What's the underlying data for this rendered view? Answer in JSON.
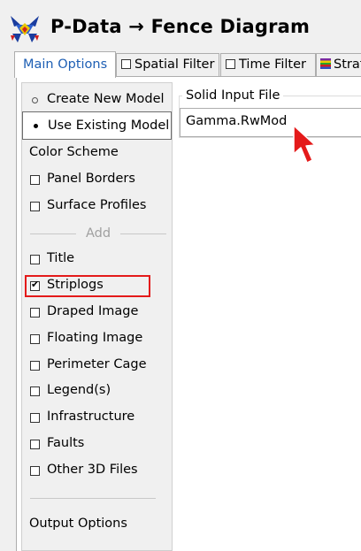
{
  "window": {
    "title": "P-Data → Fence Diagram"
  },
  "tabs": [
    {
      "label": "Main Options"
    },
    {
      "label": "Spatial Filter"
    },
    {
      "label": "Time Filter"
    },
    {
      "label": "Strat"
    }
  ],
  "model_options": [
    {
      "label": "Create New Model",
      "selected": false
    },
    {
      "label": "Use Existing Model",
      "selected": true
    }
  ],
  "left_panel": {
    "color_scheme": "Color Scheme",
    "panel_borders": "Panel Borders",
    "surface_profiles": "Surface Profiles",
    "add_divider": "Add",
    "items": [
      {
        "label": "Title",
        "checked": false
      },
      {
        "label": "Striplogs",
        "checked": true
      },
      {
        "label": "Draped Image",
        "checked": false
      },
      {
        "label": "Floating Image",
        "checked": false
      },
      {
        "label": "Perimeter Cage",
        "checked": false
      },
      {
        "label": "Legend(s)",
        "checked": false
      },
      {
        "label": "Infrastructure",
        "checked": false
      },
      {
        "label": "Faults",
        "checked": false
      },
      {
        "label": "Other 3D Files",
        "checked": false
      }
    ],
    "output_options": "Output Options"
  },
  "solid_input": {
    "group_label": "Solid Input File",
    "value": "Gamma.RwMod"
  },
  "colors": {
    "active_tab_text": "#1e5fb4",
    "highlight_box": "#e41a1a",
    "pointer_arrow": "#e41a1a"
  }
}
